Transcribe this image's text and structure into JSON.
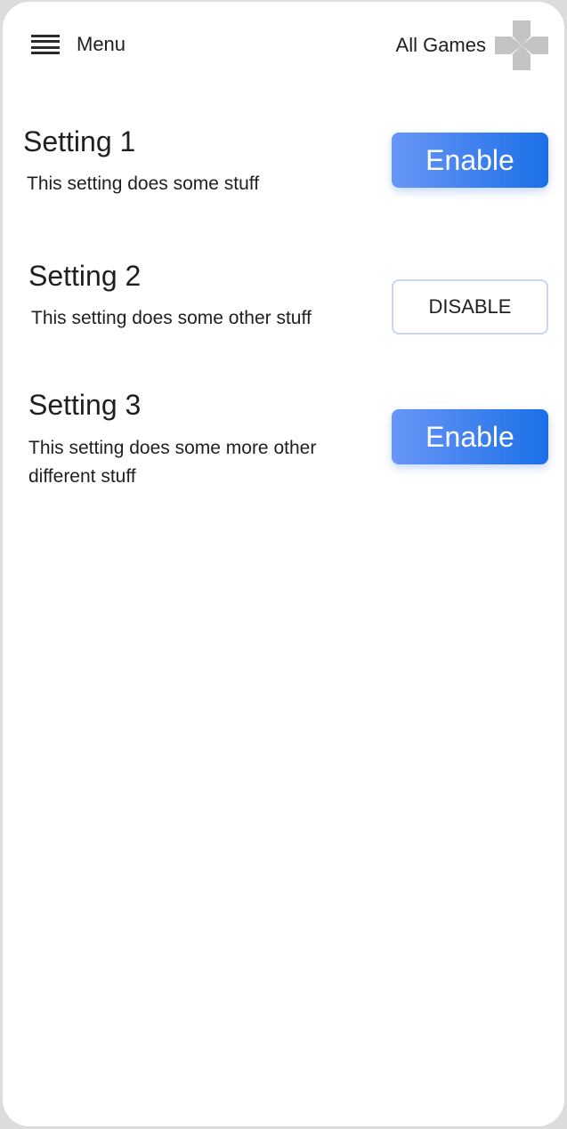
{
  "header": {
    "menu_label": "Menu",
    "games_label": "All Games",
    "menu_icon": "hamburger-icon",
    "games_icon": "gamepad-icon"
  },
  "settings": [
    {
      "title": "Setting 1",
      "description": "This setting does some stuff",
      "button_label": "Enable",
      "button_style": "primary"
    },
    {
      "title": "Setting 2",
      "description": "This setting does some other stuff",
      "button_label": "DISABLE",
      "button_style": "outline"
    },
    {
      "title": "Setting 3",
      "description": "This setting does some more other different stuff",
      "button_label": "Enable",
      "button_style": "primary"
    }
  ],
  "colors": {
    "primary_gradient_start": "#6896f5",
    "primary_gradient_end": "#1c6fe9",
    "outline_border": "#c9d6f1",
    "icon_gray": "#c4c4c4",
    "text": "#1f1f1f"
  }
}
